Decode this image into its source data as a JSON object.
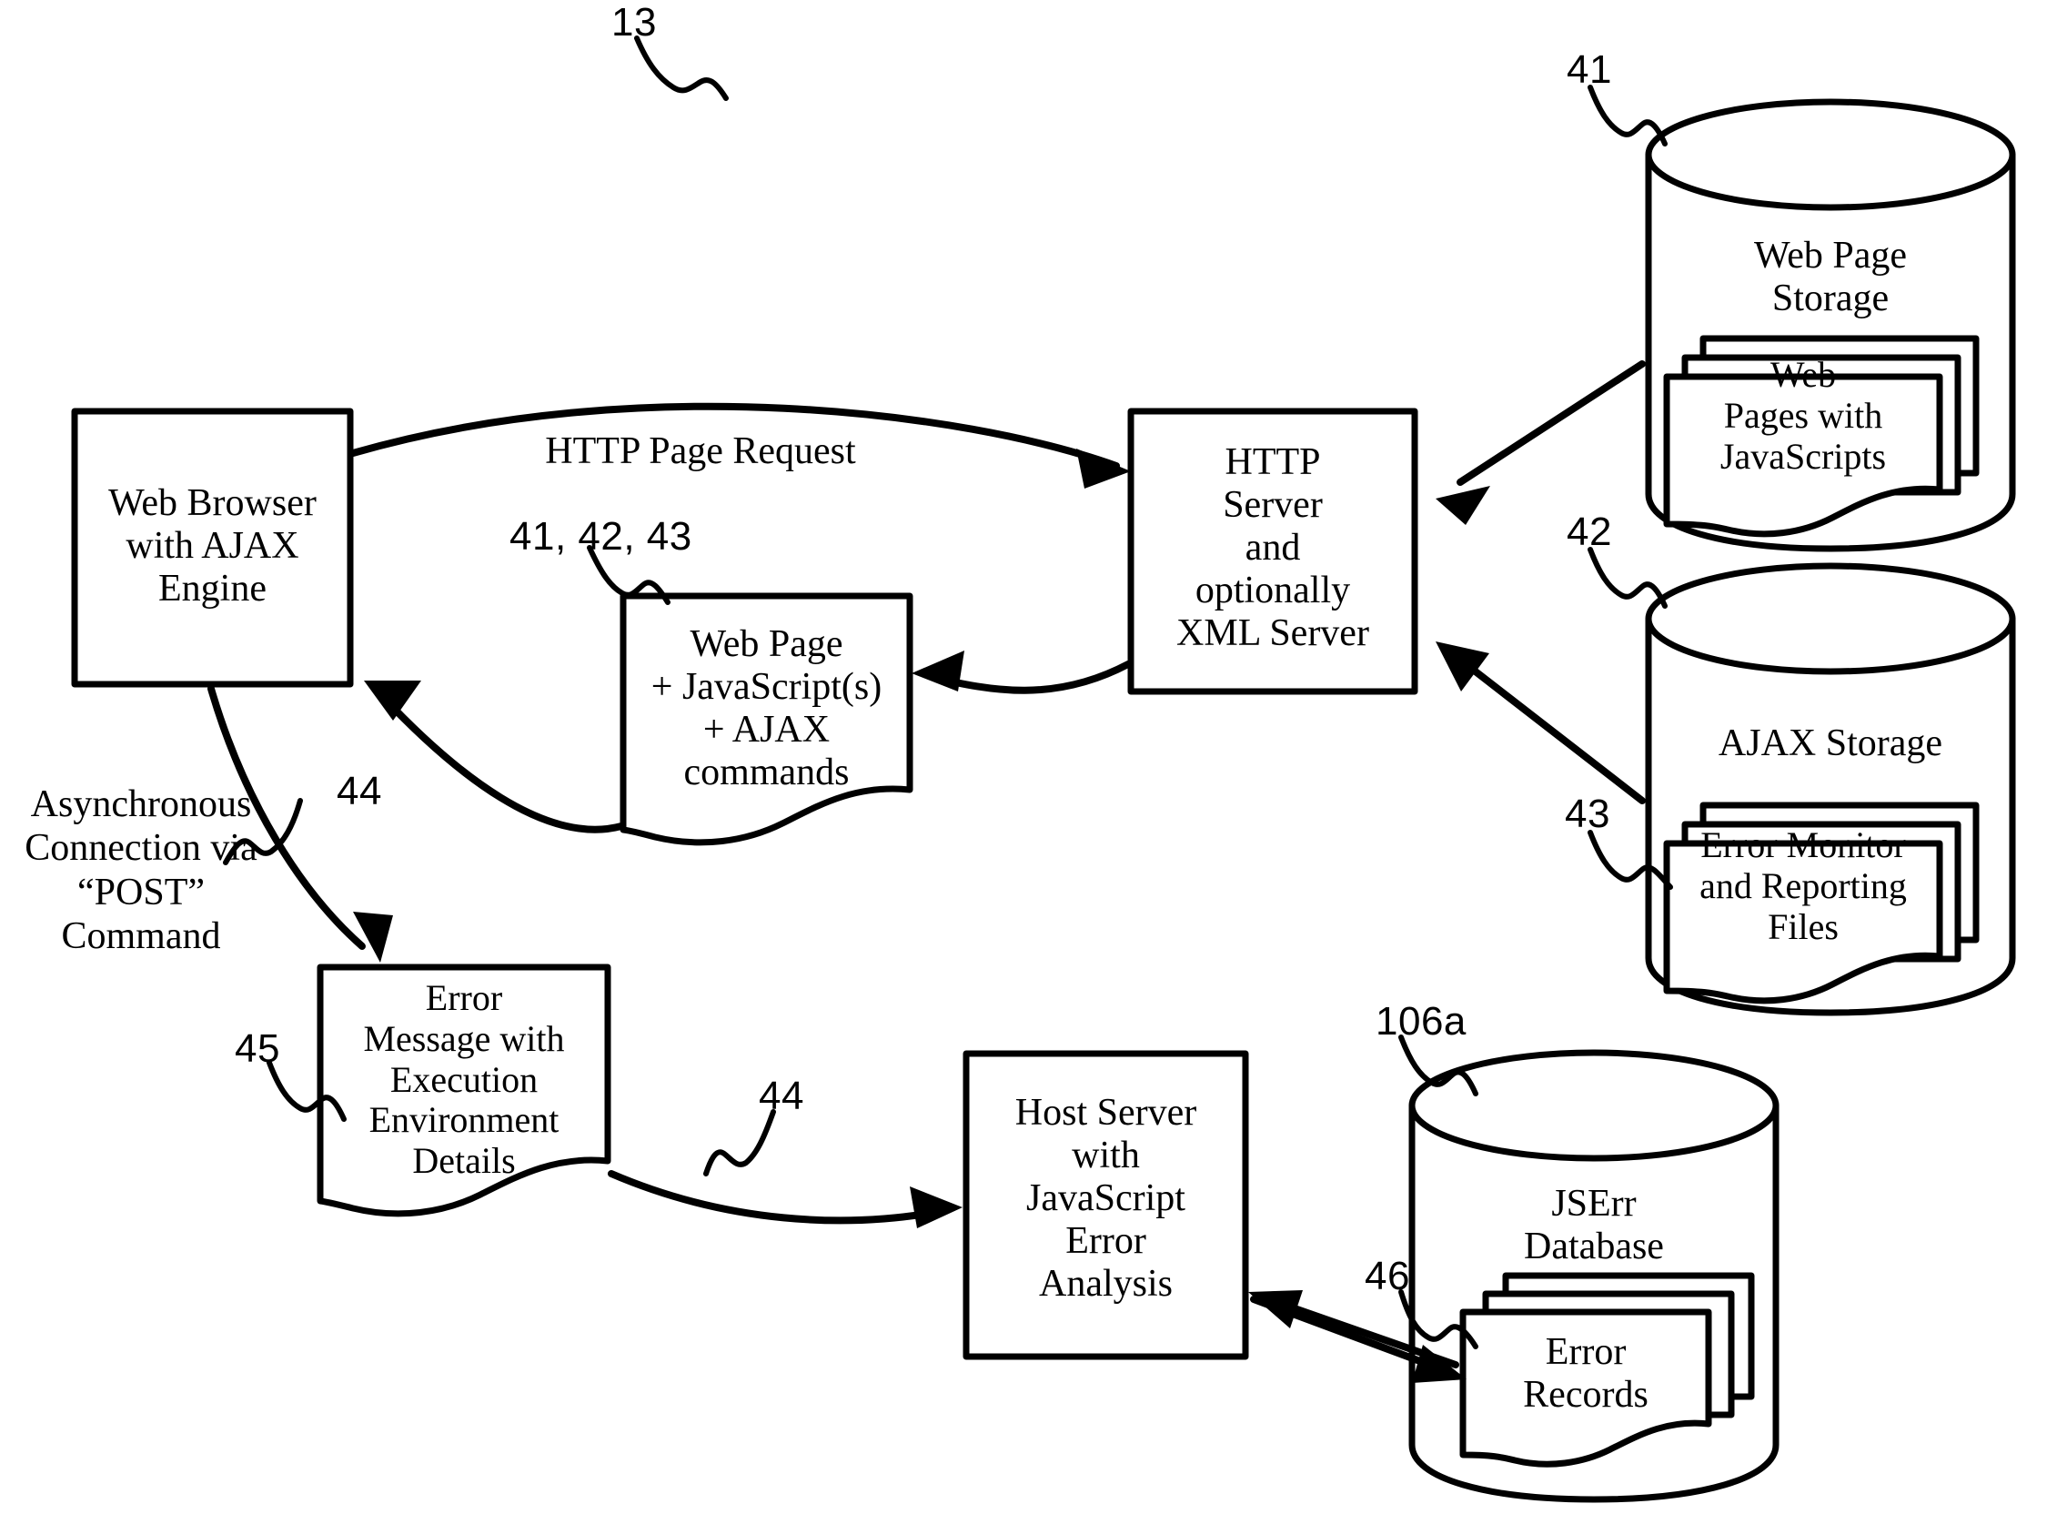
{
  "figure": {
    "figure_ref": "13"
  },
  "nodes": {
    "web_browser": {
      "label": "Web Browser\nwith AJAX\nEngine"
    },
    "http_server": {
      "label": "HTTP\nServer\nand\noptionally\nXML Server"
    },
    "web_page_doc": {
      "label": "Web Page\n+ JavaScript(s)\n+ AJAX\ncommands",
      "ref": "41, 42, 43"
    },
    "error_message_doc": {
      "label": "Error\nMessage with\nExecution\nEnvironment\nDetails",
      "ref": "45"
    },
    "host_server": {
      "label": "Host Server\nwith\nJavaScript\nError\nAnalysis"
    },
    "web_page_storage": {
      "label": "Web Page\nStorage",
      "ref": "41",
      "inner_label": "Web\nPages with\nJavaScripts"
    },
    "ajax_storage": {
      "label": "AJAX Storage",
      "ref": "42",
      "inner_label": "Error Monitor\nand Reporting\nFiles",
      "inner_ref": "43"
    },
    "jserr_database": {
      "label": "JSErr\nDatabase",
      "ref": "106a",
      "inner_label": "Error\nRecords",
      "inner_ref": "46"
    }
  },
  "edges": {
    "http_page_request": {
      "label": "HTTP Page Request"
    },
    "async_post": {
      "label": "Asynchronous\nConnection via\n“POST”\nCommand",
      "ref": "44"
    },
    "error_to_host": {
      "ref": "44"
    }
  },
  "colors": {
    "stroke": "#000000",
    "background": "#ffffff"
  }
}
